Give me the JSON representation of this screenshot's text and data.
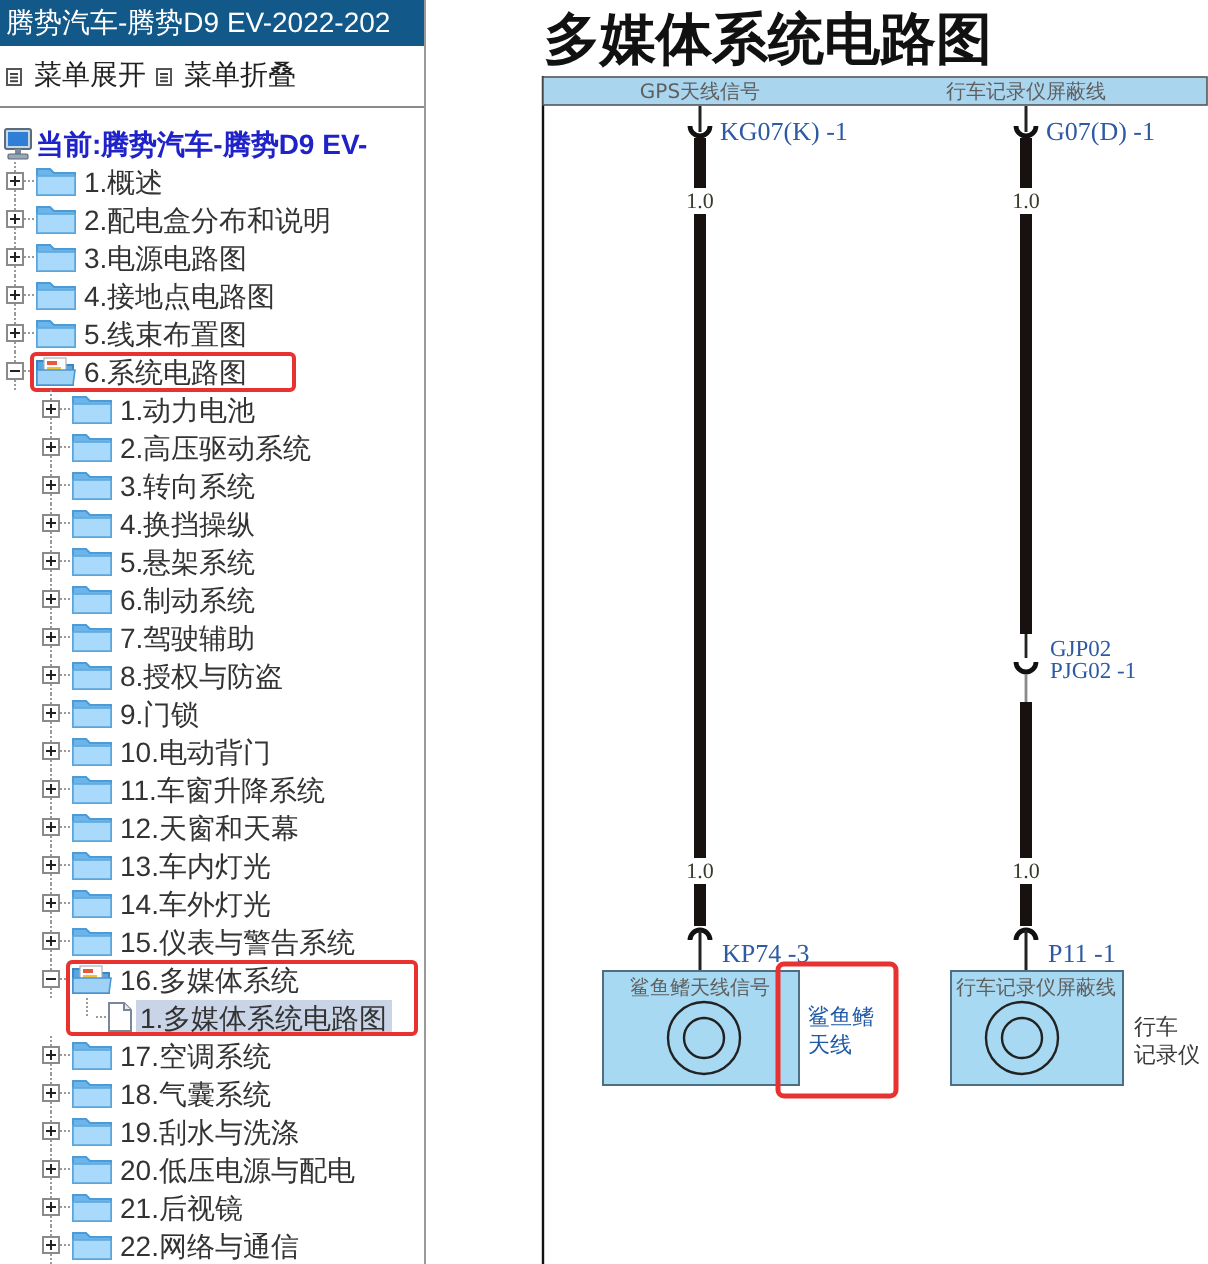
{
  "window": {
    "title": "腾势汽车-腾势D9 EV-2022-202"
  },
  "toolbar": [
    {
      "label": "菜单展开"
    },
    {
      "label": "菜单折叠"
    }
  ],
  "tree": {
    "root": "当前:腾势汽车-腾势D9 EV-",
    "items": [
      {
        "kind": "folder",
        "label": "1.概述",
        "expanded": false,
        "selected": false
      },
      {
        "kind": "folder",
        "label": "2.配电盒分布和说明",
        "expanded": false,
        "selected": false
      },
      {
        "kind": "folder",
        "label": "3.电源电路图",
        "expanded": false,
        "selected": false
      },
      {
        "kind": "folder",
        "label": "4.接地点电路图",
        "expanded": false,
        "selected": false
      },
      {
        "kind": "folder",
        "label": "5.线束布置图",
        "expanded": false,
        "selected": false
      },
      {
        "kind": "folder",
        "label": "6.系统电路图",
        "expanded": true,
        "selected": false,
        "highlighted": true,
        "children": [
          {
            "kind": "folder",
            "label": "1.动力电池",
            "expanded": false,
            "selected": false
          },
          {
            "kind": "folder",
            "label": "2.高压驱动系统",
            "expanded": false,
            "selected": false
          },
          {
            "kind": "folder",
            "label": "3.转向系统",
            "expanded": false,
            "selected": false
          },
          {
            "kind": "folder",
            "label": "4.换挡操纵",
            "expanded": false,
            "selected": false
          },
          {
            "kind": "folder",
            "label": "5.悬架系统",
            "expanded": false,
            "selected": false
          },
          {
            "kind": "folder",
            "label": "6.制动系统",
            "expanded": false,
            "selected": false
          },
          {
            "kind": "folder",
            "label": "7.驾驶辅助",
            "expanded": false,
            "selected": false
          },
          {
            "kind": "folder",
            "label": "8.授权与防盗",
            "expanded": false,
            "selected": false
          },
          {
            "kind": "folder",
            "label": "9.门锁",
            "expanded": false,
            "selected": false
          },
          {
            "kind": "folder",
            "label": "10.电动背门",
            "expanded": false,
            "selected": false
          },
          {
            "kind": "folder",
            "label": "11.车窗升降系统",
            "expanded": false,
            "selected": false
          },
          {
            "kind": "folder",
            "label": "12.天窗和天幕",
            "expanded": false,
            "selected": false
          },
          {
            "kind": "folder",
            "label": "13.车内灯光",
            "expanded": false,
            "selected": false
          },
          {
            "kind": "folder",
            "label": "14.车外灯光",
            "expanded": false,
            "selected": false
          },
          {
            "kind": "folder",
            "label": "15.仪表与警告系统",
            "expanded": false,
            "selected": false
          },
          {
            "kind": "folder",
            "label": "16.多媒体系统",
            "expanded": true,
            "selected": false,
            "highlighted": true,
            "highlight_children": true,
            "children": [
              {
                "kind": "document",
                "label": "1.多媒体系统电路图",
                "selected": true
              }
            ]
          },
          {
            "kind": "folder",
            "label": "17.空调系统",
            "expanded": false,
            "selected": false
          },
          {
            "kind": "folder",
            "label": "18.气囊系统",
            "expanded": false,
            "selected": false
          },
          {
            "kind": "folder",
            "label": "19.刮水与洗涤",
            "expanded": false,
            "selected": false
          },
          {
            "kind": "folder",
            "label": "20.低压电源与配电",
            "expanded": false,
            "selected": false
          },
          {
            "kind": "folder",
            "label": "21.后视镜",
            "expanded": false,
            "selected": false
          },
          {
            "kind": "folder",
            "label": "22.网络与通信",
            "expanded": false,
            "selected": false
          }
        ]
      }
    ]
  },
  "page": {
    "title": "多媒体系统电路图"
  },
  "diagram": {
    "circuits": [
      {
        "signal": "GPS天线信号",
        "top_connector": "KG07(K) -1",
        "gauges": [
          "1.0",
          "1.0"
        ],
        "bottom_connector": "KP74 -3",
        "component": {
          "pin_label": "鲨鱼鳍天线信号",
          "name": "鲨鱼鳍天线",
          "color": "#1f5aa6",
          "highlighted": true
        }
      },
      {
        "signal": "行车记录仪屏蔽线",
        "top_connector": "G07(D) -1",
        "inline_connector": [
          "GJP02",
          "PJG02 -1"
        ],
        "gauges": [
          "1.0",
          "1.0"
        ],
        "bottom_connector": "P11 -1",
        "component": {
          "pin_label": "行车记录仪屏蔽线",
          "name": "行车记录仪",
          "color": "#3a3a3a"
        }
      }
    ]
  }
}
